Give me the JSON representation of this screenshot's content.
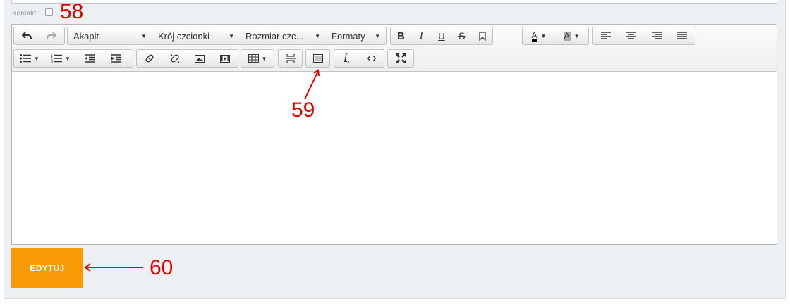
{
  "form": {
    "kontakt_label": "Kontakt:",
    "kontakt_checked": false,
    "submit_label": "EDYTUJ"
  },
  "annotations": {
    "a58": "58",
    "a59": "59",
    "a60": "60",
    "color": "#e00000"
  },
  "toolbar": {
    "paragraph_select": "Akapit",
    "font_family_select": "Krój czcionki",
    "font_size_select": "Rozmiar czc...",
    "formats_select": "Formaty",
    "icons": [
      "undo-icon",
      "redo-icon",
      "bold-icon",
      "italic-icon",
      "underline-icon",
      "strikethrough-icon",
      "bookmark-icon",
      "text-color-icon",
      "background-color-icon",
      "align-left-icon",
      "align-center-icon",
      "align-right-icon",
      "align-justify-icon",
      "bullet-list-icon",
      "numbered-list-icon",
      "outdent-icon",
      "indent-icon",
      "link-icon",
      "unlink-icon",
      "image-icon",
      "media-icon",
      "table-icon",
      "page-break-icon",
      "template-icon",
      "clear-formatting-icon",
      "source-code-icon",
      "fullscreen-icon"
    ]
  },
  "colors": {
    "accent": "#f89a05",
    "panel_bg": "#edf0f3"
  }
}
